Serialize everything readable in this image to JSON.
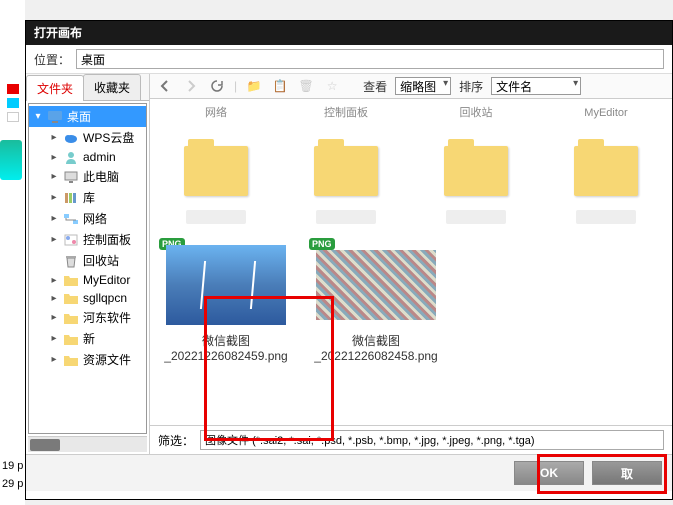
{
  "bg": {
    "label19": "19 p",
    "label29": "29 p"
  },
  "dialog": {
    "title": "打开画布",
    "location_label": "位置：",
    "location_value": "桌面"
  },
  "tabs": {
    "folders": "文件夹",
    "favorites": "收藏夹"
  },
  "tree": {
    "items": [
      {
        "label": "桌面",
        "icon": "desktop",
        "depth": 0,
        "arrow": "▾",
        "selected": true
      },
      {
        "label": "WPS云盘",
        "icon": "cloud",
        "depth": 1,
        "arrow": "▸"
      },
      {
        "label": "admin",
        "icon": "user",
        "depth": 1,
        "arrow": "▸"
      },
      {
        "label": "此电脑",
        "icon": "pc",
        "depth": 1,
        "arrow": "▸"
      },
      {
        "label": "库",
        "icon": "lib",
        "depth": 1,
        "arrow": "▸"
      },
      {
        "label": "网络",
        "icon": "net",
        "depth": 1,
        "arrow": "▸"
      },
      {
        "label": "控制面板",
        "icon": "ctrl",
        "depth": 1,
        "arrow": "▸"
      },
      {
        "label": "回收站",
        "icon": "bin",
        "depth": 1,
        "arrow": ""
      },
      {
        "label": "MyEditor",
        "icon": "folder",
        "depth": 1,
        "arrow": "▸"
      },
      {
        "label": "sgllqpcn",
        "icon": "folder",
        "depth": 1,
        "arrow": "▸"
      },
      {
        "label": "河东软件",
        "icon": "folder",
        "depth": 1,
        "arrow": "▸"
      },
      {
        "label": "新",
        "icon": "folder",
        "depth": 1,
        "arrow": "▸"
      },
      {
        "label": "资源文件",
        "icon": "folder",
        "depth": 1,
        "arrow": "▸"
      }
    ]
  },
  "toolbar": {
    "view_label": "查看",
    "view_value": "缩略图",
    "sort_label": "排序",
    "sort_value": "文件名"
  },
  "grid": {
    "row0": [
      {
        "label": "网络"
      },
      {
        "label": "控制面板"
      },
      {
        "label": "回收站"
      },
      {
        "label": "MyEditor"
      }
    ],
    "row1": [
      {
        "label": ""
      },
      {
        "label": ""
      },
      {
        "label": ""
      },
      {
        "label": ""
      }
    ],
    "row2_item0": {
      "line1": "微信截图",
      "line2": "_20221226082459.png"
    },
    "row2_item1": {
      "line1": "微信截图",
      "line2": "_20221226082458.png"
    }
  },
  "filter": {
    "label": "筛选：",
    "value": "图像文件 (*.sai2, *.sai, *.psd, *.psb, *.bmp, *.jpg, *.jpeg, *.png, *.tga)"
  },
  "buttons": {
    "ok": "OK",
    "cancel": "取"
  }
}
